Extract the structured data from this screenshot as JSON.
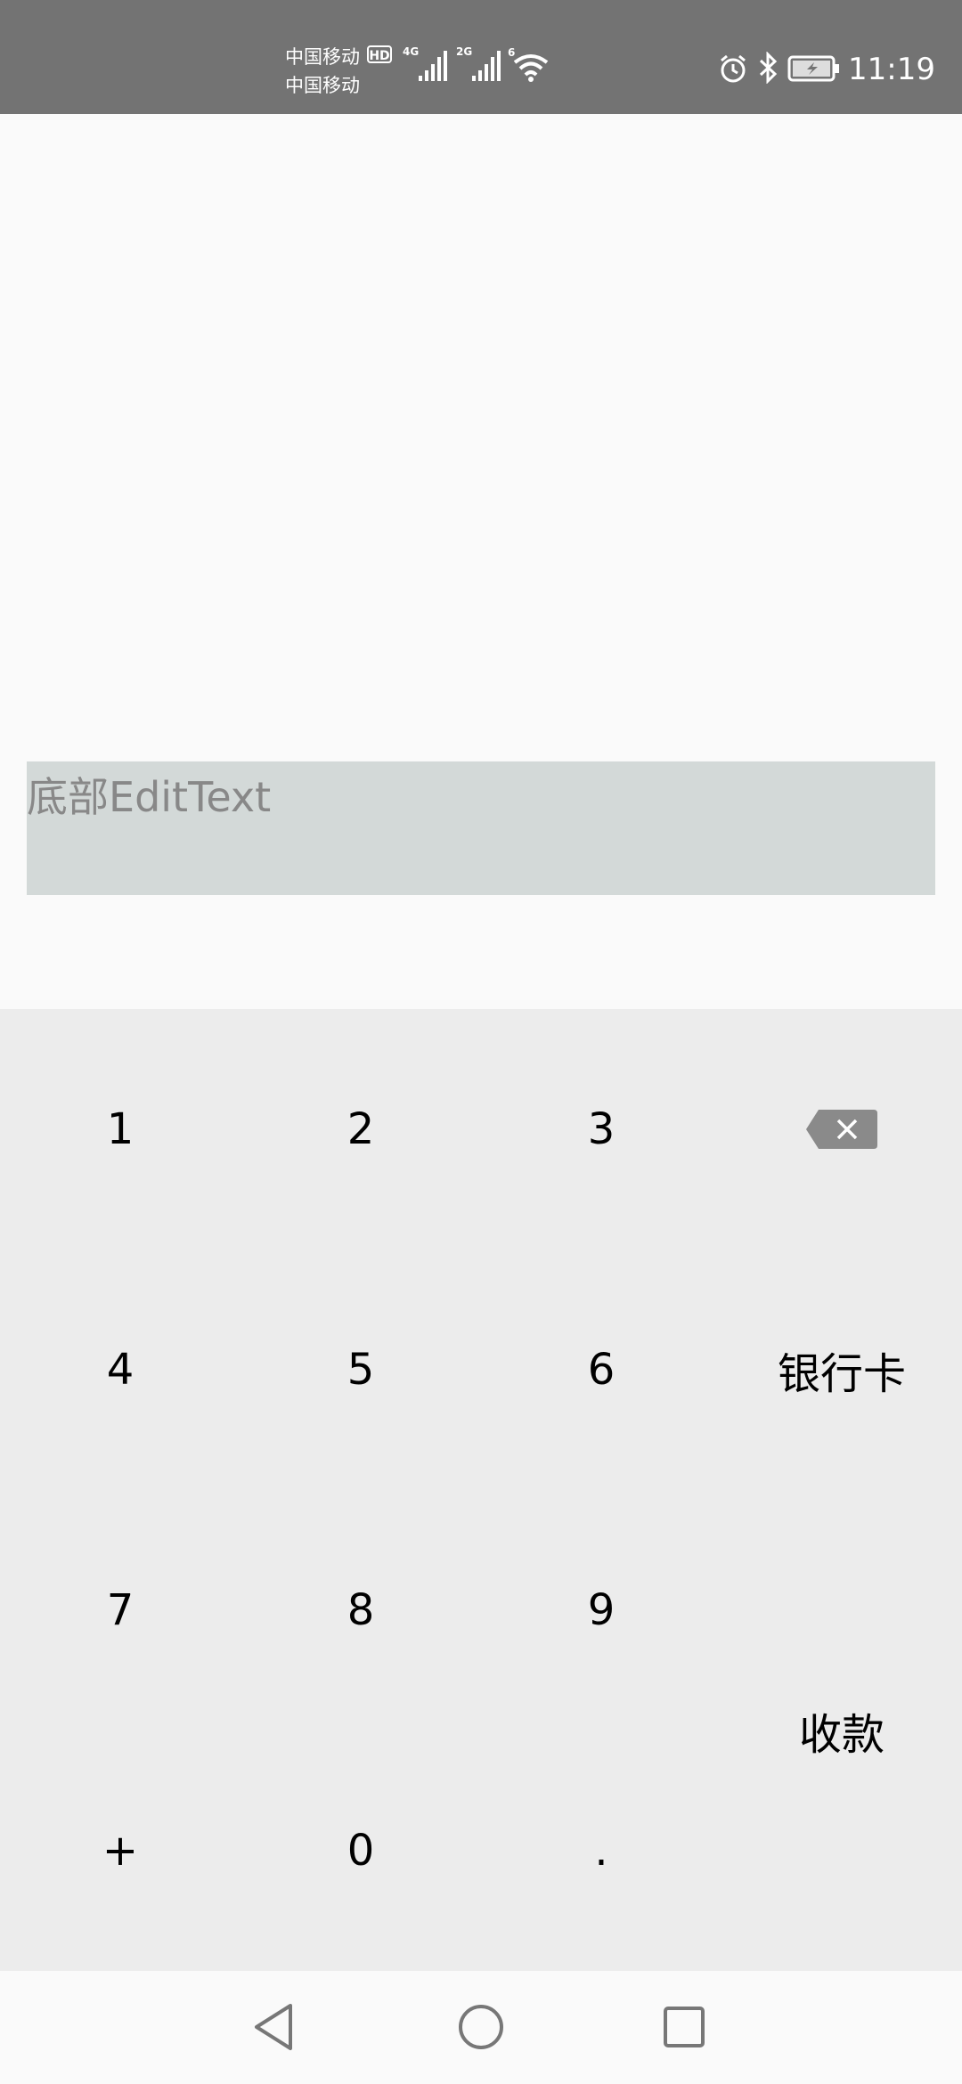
{
  "status_bar": {
    "carrier_1": "中国移动",
    "carrier_2": "中国移动",
    "hd_label": "HD",
    "sim1_network": "4G",
    "sim2_network": "2G",
    "wifi_label": "6",
    "time": "11:19",
    "icons": [
      "signal-icon",
      "signal-icon",
      "wifi-icon",
      "alarm-icon",
      "bluetooth-icon",
      "battery-charging-icon"
    ]
  },
  "edit_text": {
    "hint": "底部EditText"
  },
  "keyboard": {
    "keys": {
      "k1": "1",
      "k2": "2",
      "k3": "3",
      "k4": "4",
      "k5": "5",
      "k6": "6",
      "k7": "7",
      "k8": "8",
      "k9": "9",
      "plus": "+",
      "k0": "0",
      "dot": "."
    },
    "bank_card_label": "银行卡",
    "collect_label": "收款",
    "delete_icon": "backspace-icon"
  },
  "nav_bar": {
    "icons": [
      "back-icon",
      "home-icon",
      "recents-icon"
    ]
  },
  "colors": {
    "status_bar_bg": "#737373",
    "edit_text_bg": "#d3d9d8",
    "keyboard_bg": "#ececec",
    "hint_text": "#888888"
  }
}
